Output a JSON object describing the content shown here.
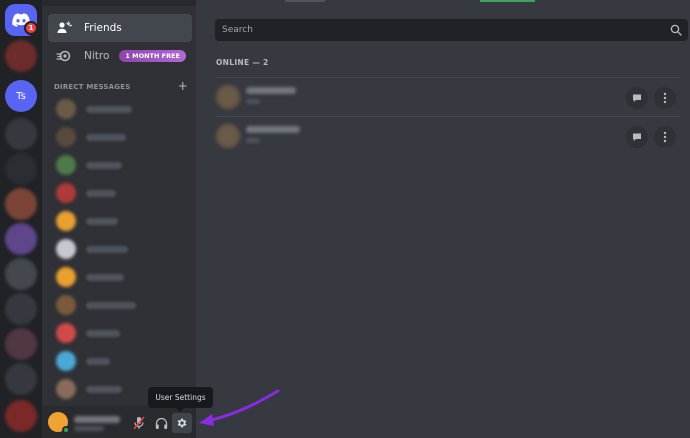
{
  "server_rail": {
    "home_badge": "1",
    "ts_server": "Ts"
  },
  "sidebar": {
    "friends_label": "Friends",
    "nitro_label": "Nitro",
    "nitro_badge": "1 MONTH FREE",
    "dm_header": "DIRECT MESSAGES",
    "dm_add": "+"
  },
  "search": {
    "placeholder": "Search"
  },
  "friends_list": {
    "header": "ONLINE — 2"
  },
  "tooltip": {
    "text": "User Settings"
  },
  "colors": {
    "blurple": "#5865f2",
    "nitro_purple": "#9b59b6",
    "online_green": "#3ba55d",
    "annotation_arrow": "#8a2be2"
  },
  "icons": {
    "friends": "friends-wave-icon",
    "nitro": "nitro-icon",
    "mic": "mic-muted-icon",
    "headphones": "headphones-icon",
    "settings": "gear-icon",
    "message": "chat-bubble-icon",
    "more": "vertical-dots-icon",
    "search": "search-icon"
  }
}
